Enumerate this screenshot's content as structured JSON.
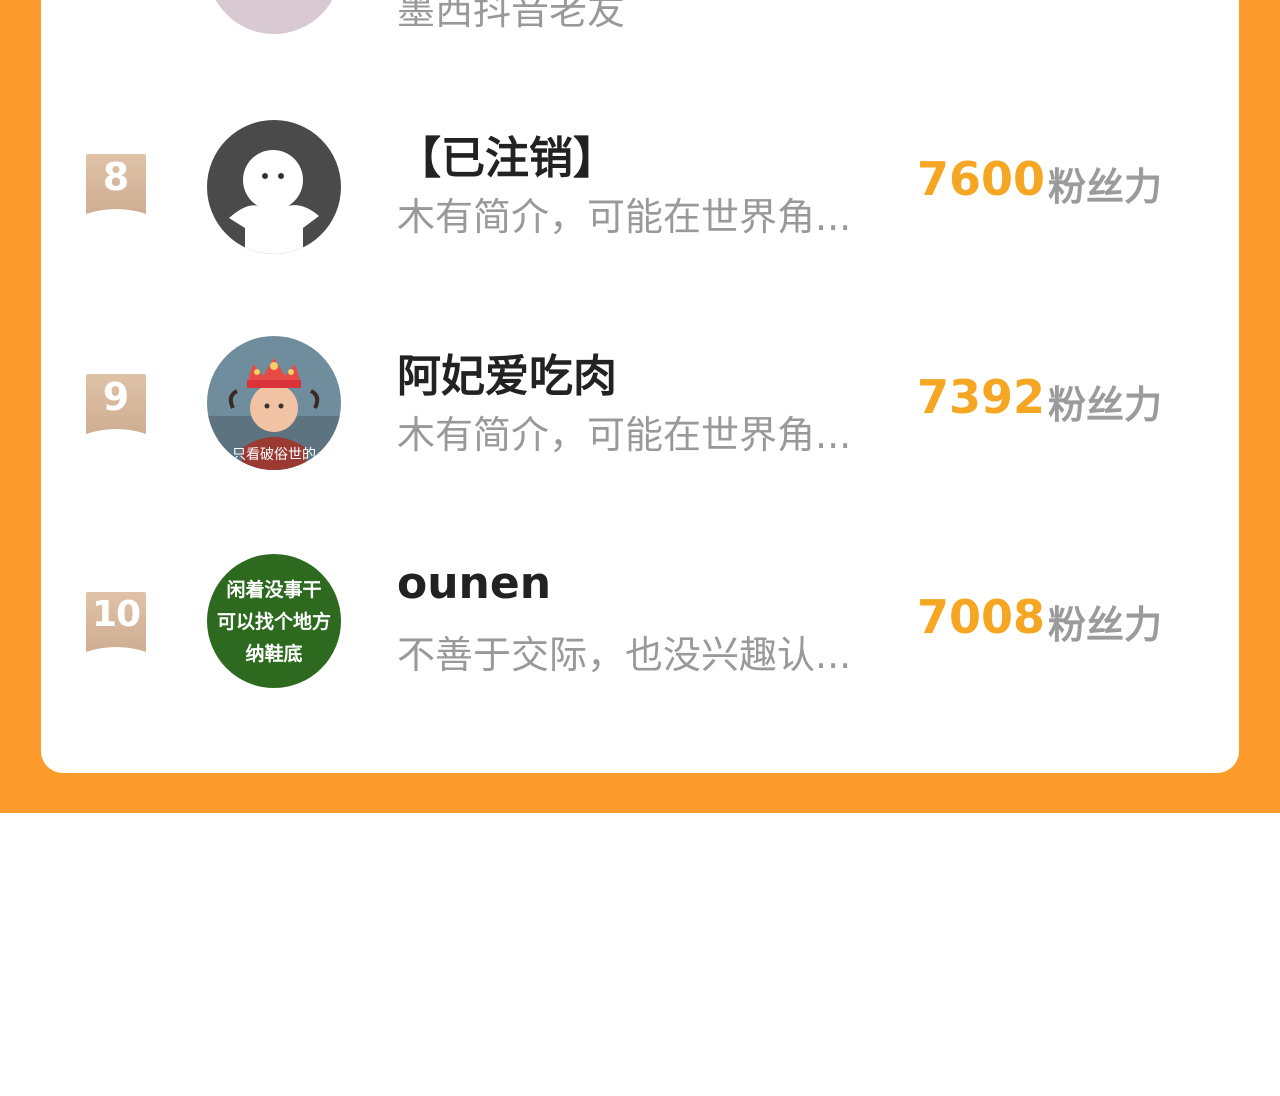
{
  "leaderboard": {
    "partial_row": {
      "bio": "墨西抖音老友"
    },
    "rows": [
      {
        "rank": "8",
        "name": "【已注销】",
        "bio": "木有简介，可能在世界角...",
        "score": "7600",
        "score_unit": "粉丝力",
        "avatar": "default-user-avatar"
      },
      {
        "rank": "9",
        "name": "阿妃爱吃肉",
        "bio": "木有简介，可能在世界角...",
        "score": "7392",
        "score_unit": "粉丝力",
        "avatar": "baby-photo-avatar",
        "avatar_caption": "只看破俗世的"
      },
      {
        "rank": "10",
        "name": "ounen",
        "bio": "不善于交际，也没兴趣认...",
        "score": "7008",
        "score_unit": "粉丝力",
        "avatar": "text-avatar",
        "avatar_lines": [
          "闲着没事干",
          "可以找个地方",
          "纳鞋底"
        ]
      }
    ]
  },
  "colors": {
    "background_orange": "#fd9c2c",
    "score": "#f5a623",
    "badge": "#d9b79a",
    "name": "#222222",
    "muted": "#999999",
    "text_avatar_green": "#2d6a1f"
  }
}
